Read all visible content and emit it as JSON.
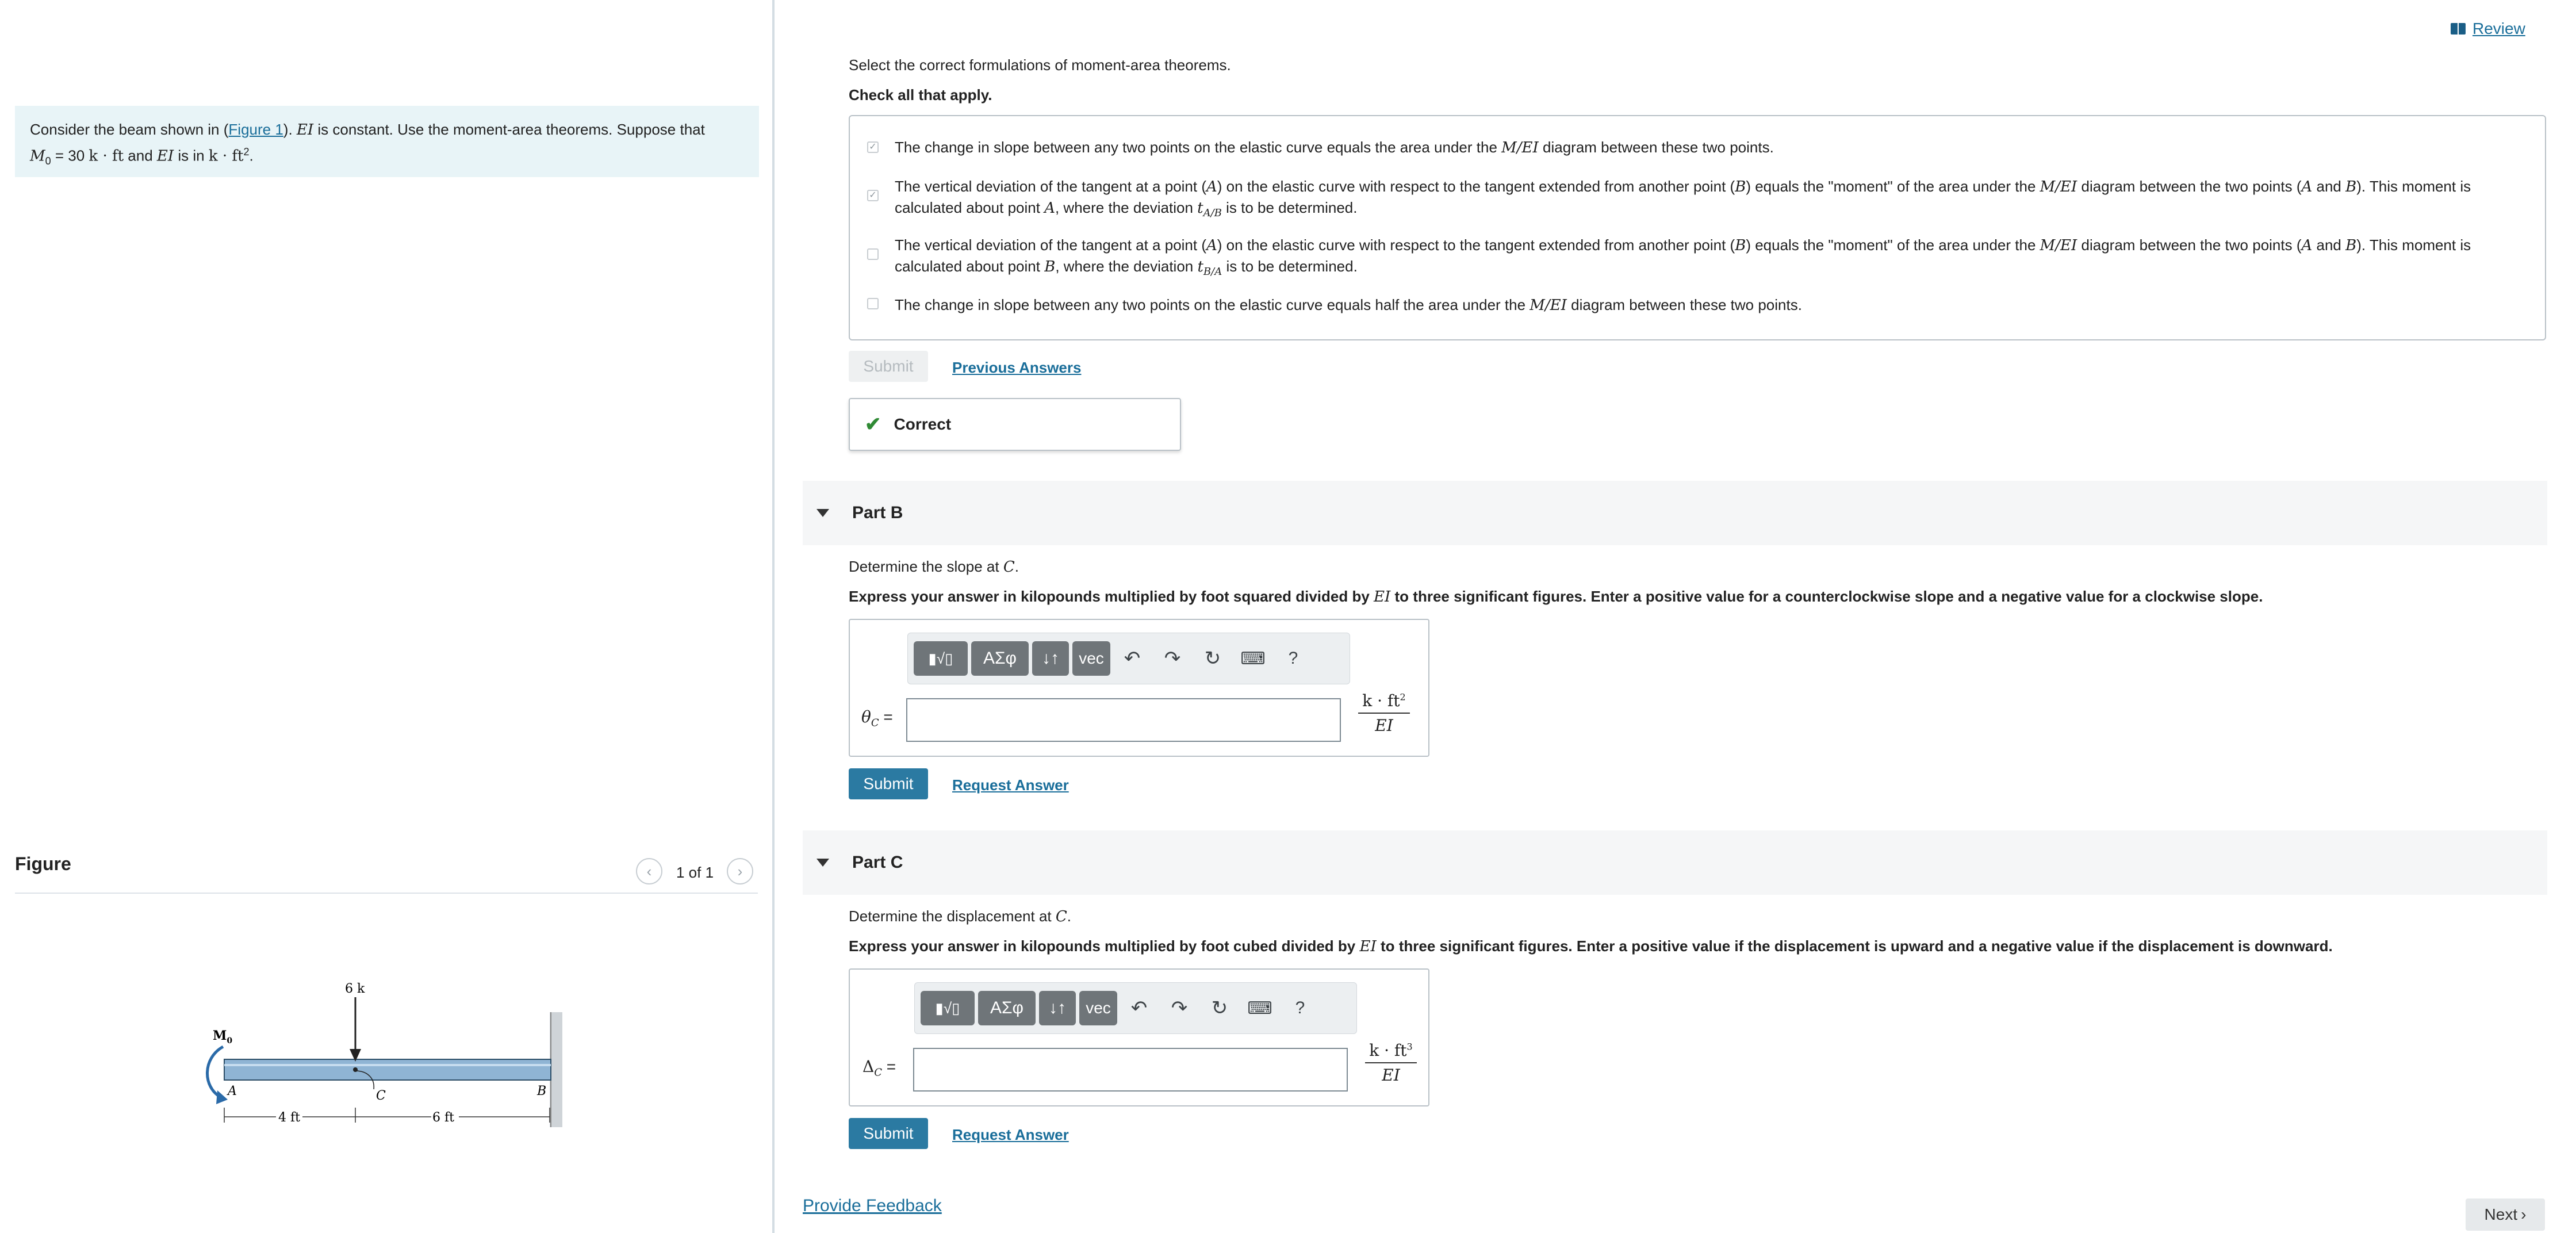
{
  "review_label": "Review",
  "problem": {
    "t1": "Consider the beam shown in (",
    "figure_link": "Figure 1",
    "t2": "). ",
    "ei1": "EI",
    "t3": " is constant. Use the moment-area theorems. Suppose that",
    "m0_sym": "M",
    "m0_sub": "0",
    "m0_eq": " = 30 ",
    "m0_unit": "k · ft",
    "t4": " and ",
    "ei2": "EI",
    "t5": " is in ",
    "ei_unit": "k · ft",
    "ei_unit_sup": "2",
    "t6": "."
  },
  "figure": {
    "title": "Figure",
    "count": "1 of 1",
    "labels": {
      "load": "6 k",
      "moment": "M",
      "moment_sub": "0",
      "a": "A",
      "b": "B",
      "c": "C",
      "span1": "4 ft",
      "span2": "6 ft"
    }
  },
  "part_a": {
    "prompt": "Select the correct formulations of moment-area theorems.",
    "instruction": "Check all that apply.",
    "choices": [
      {
        "checked": true,
        "parts": [
          "The change in slope between any two points on the elastic curve equals the area under the ",
          "M/EI",
          " diagram between these two points."
        ]
      },
      {
        "checked": true,
        "line1": [
          "The vertical deviation of the tangent at a point (",
          "A",
          ") on the elastic curve with respect to the tangent extended from another point (",
          "B",
          ") equals the \"moment\" of the area under the ",
          "M/EI",
          " diagram between the two points (",
          "A",
          " and ",
          "B",
          "). This moment is"
        ],
        "line2": [
          "calculated about point ",
          "A",
          ", where the deviation ",
          "t",
          "A/B",
          " is to be determined."
        ]
      },
      {
        "checked": false,
        "line1": [
          "The vertical deviation of the tangent at a point (",
          "A",
          ") on the elastic curve with respect to the tangent extended from another point (",
          "B",
          ") equals the \"moment\" of the area under the ",
          "M/EI",
          " diagram between the two points (",
          "A",
          " and ",
          "B",
          "). This moment is"
        ],
        "line2": [
          "calculated about point ",
          "B",
          ", where the deviation ",
          "t",
          "B/A",
          " is to be determined."
        ]
      },
      {
        "checked": false,
        "parts": [
          "The change in slope between any two points on the elastic curve equals half the area under the ",
          "M/EI",
          " diagram between these two points."
        ]
      }
    ],
    "submit_label": "Submit",
    "previous_answers": "Previous Answers",
    "result": "Correct"
  },
  "part_b": {
    "title": "Part B",
    "prompt_pre": "Determine the slope at ",
    "prompt_var": "C",
    "prompt_post": ".",
    "instr_pre": "Express your answer in kilopounds multiplied by foot squared divided by ",
    "instr_var": "EI",
    "instr_post": " to three significant figures. Enter a positive value for a counterclockwise slope and a negative value for a clockwise slope.",
    "label_sym": "θ",
    "label_sub": "C",
    "label_eq": " =",
    "input_value": "",
    "units_num": "k · ft",
    "units_sup": "2",
    "units_den": "EI",
    "submit_label": "Submit",
    "request_answer": "Request Answer"
  },
  "part_c": {
    "title": "Part C",
    "prompt_pre": "Determine the displacement at ",
    "prompt_var": "C",
    "prompt_post": ".",
    "instr_pre": "Express your answer in kilopounds multiplied by foot cubed divided by ",
    "instr_var": "EI",
    "instr_post": " to three significant figures. Enter a positive value if the displacement is upward and a negative value if the displacement is downward.",
    "label_sym": "Δ",
    "label_sub": "C",
    "label_eq": " =",
    "input_value": "",
    "units_num": "k · ft",
    "units_sup": "3",
    "units_den": "EI",
    "submit_label": "Submit",
    "request_answer": "Request Answer"
  },
  "toolbar": {
    "greek": "ΑΣφ",
    "arrows": "↓↑",
    "vec": "vec",
    "help": "?"
  },
  "footer": {
    "feedback": "Provide Feedback",
    "next": "Next"
  },
  "colors": {
    "accent": "#2b7aa2",
    "link": "#1a6e9a",
    "correct": "#2f8a34",
    "problem_bg": "#e8f4f7",
    "beam": "#8fb4d4"
  }
}
